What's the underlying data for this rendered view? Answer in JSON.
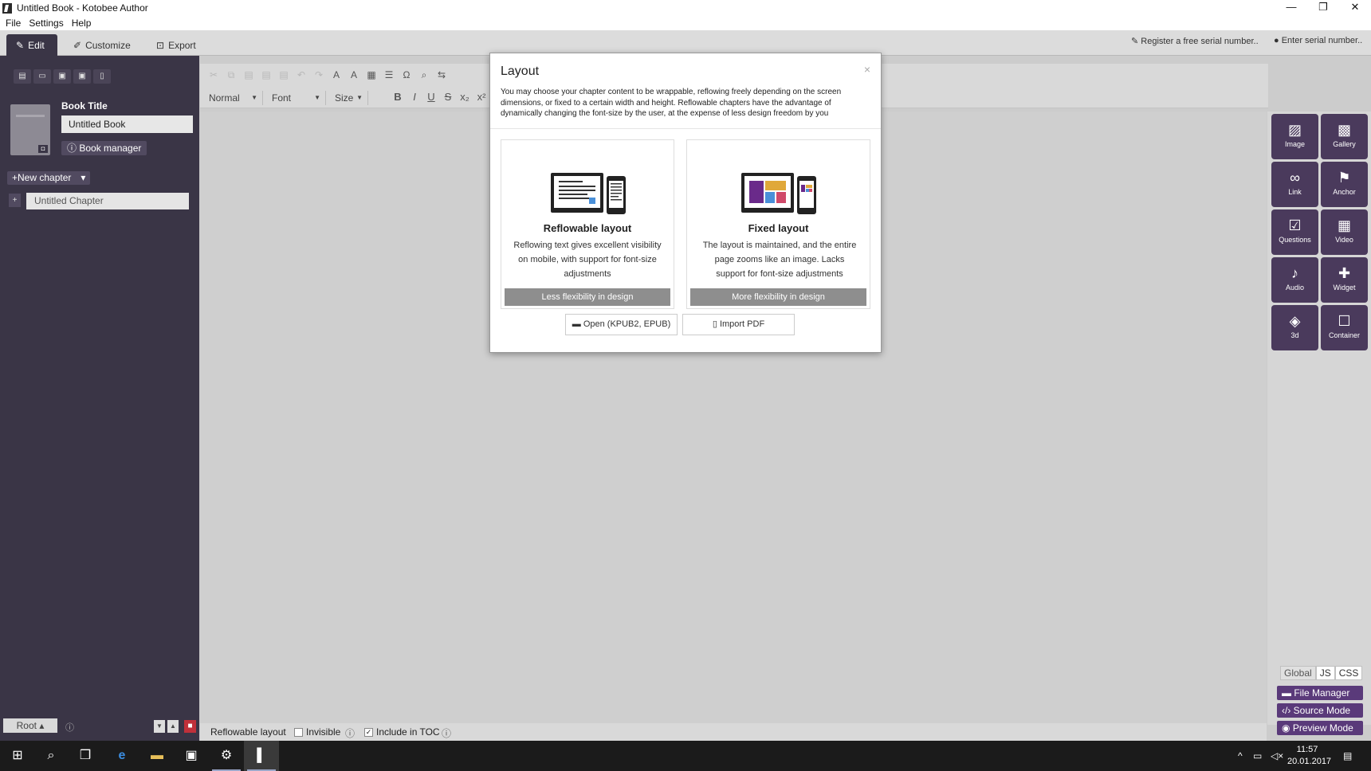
{
  "window": {
    "title": "Untitled Book - Kotobee Author",
    "controls": [
      "—",
      "❐",
      "✕"
    ]
  },
  "menu": [
    "File",
    "Settings",
    "Help"
  ],
  "tabs": [
    {
      "label": "Edit",
      "icon": "pencil-icon"
    },
    {
      "label": "Customize",
      "icon": "brush-icon"
    },
    {
      "label": "Export",
      "icon": "export-icon"
    }
  ],
  "header_links": {
    "register": "Register a free serial number..",
    "serial": "Enter serial number.."
  },
  "sidebar": {
    "book_title_label": "Book Title",
    "book_title_value": "Untitled Book",
    "book_manager": "Book manager",
    "new_chapter": "New chapter",
    "chapter_plus": "+",
    "chapters": [
      "Untitled Chapter"
    ],
    "root_label": "Root"
  },
  "toolbar": {
    "paragraph_style": "Normal",
    "font": "Font",
    "size": "Size"
  },
  "widgets": [
    {
      "label": "Image",
      "icon": "image-icon"
    },
    {
      "label": "Gallery",
      "icon": "gallery-icon"
    },
    {
      "label": "Link",
      "icon": "link-icon"
    },
    {
      "label": "Anchor",
      "icon": "anchor-flag-icon"
    },
    {
      "label": "Questions",
      "icon": "checkbox-icon"
    },
    {
      "label": "Video",
      "icon": "film-icon"
    },
    {
      "label": "Audio",
      "icon": "microphone-icon"
    },
    {
      "label": "Widget",
      "icon": "puzzle-icon"
    },
    {
      "label": "3d",
      "icon": "cube-icon"
    },
    {
      "label": "Container",
      "icon": "square-icon"
    }
  ],
  "right_tabs": [
    "Global",
    "JS",
    "CSS"
  ],
  "right_buttons": {
    "file_manager": "File Manager",
    "source_mode": "Source Mode",
    "preview_mode": "Preview Mode"
  },
  "statusbar": {
    "layout": "Reflowable layout",
    "invisible": "Invisible",
    "include_toc": "Include in TOC"
  },
  "modal": {
    "title": "Layout",
    "close": "×",
    "description": "You may choose your chapter content to be wrappable, reflowing freely depending on the screen dimensions, or fixed to a certain width and height. Reflowable chapters have the advantage of dynamically changing the font-size by the user, at the expense of less design freedom by you",
    "reflowable": {
      "title": "Reflowable layout",
      "description": "Reflowing text gives excellent visibility on mobile, with support for font-size adjustments",
      "button": "Less flexibility in design"
    },
    "fixed": {
      "title": "Fixed layout",
      "description": "The layout is maintained, and the entire page zooms like an image. Lacks support for font-size adjustments",
      "button": "More flexibility in design"
    },
    "open_button": "Open (KPUB2, EPUB)",
    "import_button": "Import PDF"
  },
  "taskbar": {
    "time": "11:57",
    "date": "20.01.2017"
  },
  "colors": {
    "sidebar_bg": "#3a3546",
    "widget_tile": "#4a3a5c",
    "mode_button": "#5a3a7a",
    "modal_button": "#8e8e8e"
  }
}
